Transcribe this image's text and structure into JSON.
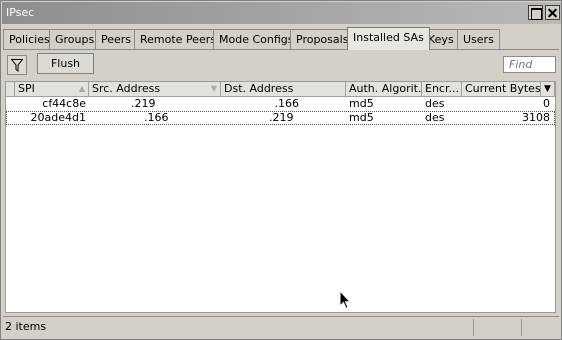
{
  "window": {
    "title": "IPsec"
  },
  "tabs": [
    {
      "label": "Policies"
    },
    {
      "label": "Groups"
    },
    {
      "label": "Peers"
    },
    {
      "label": "Remote Peers"
    },
    {
      "label": "Mode Configs"
    },
    {
      "label": "Proposals"
    },
    {
      "label": "Installed SAs"
    },
    {
      "label": "Keys"
    },
    {
      "label": "Users"
    }
  ],
  "active_tab": "Installed SAs",
  "toolbar": {
    "filter_icon": "funnel-icon",
    "flush_label": "Flush",
    "find_placeholder": "Find"
  },
  "table": {
    "columns": [
      "SPI",
      "Src. Address",
      "Dst. Address",
      "Auth. Algorit...",
      "Encr...",
      "Current Bytes"
    ],
    "rows": [
      {
        "spi": "cf44c8e",
        "src": ".219",
        "dst": ".166",
        "auth": "md5",
        "encr": "des",
        "bytes": "0"
      },
      {
        "spi": "20ade4d1",
        "src": ".166",
        "dst": ".219",
        "auth": "md5",
        "encr": "des",
        "bytes": "3108"
      }
    ]
  },
  "status": {
    "items": "2 items"
  }
}
